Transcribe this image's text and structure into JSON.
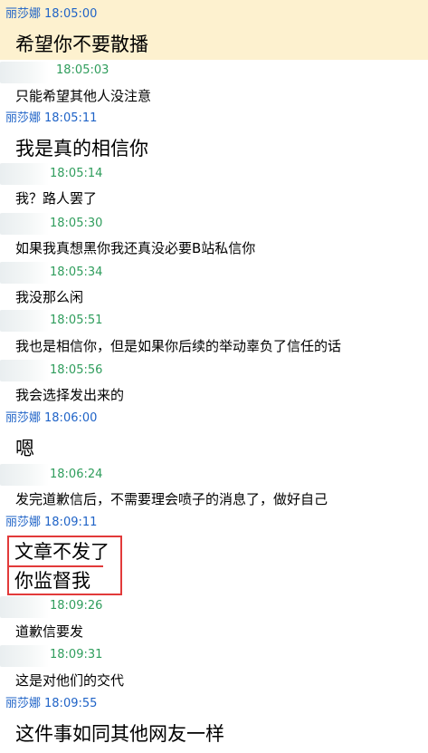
{
  "chat": {
    "highlight_color": "#fdf1cf",
    "accent_self": "#1f63c7",
    "accent_other": "#2f9d5c",
    "annotation_color": "#e23a3a",
    "messages": [
      {
        "sender": "丽莎娜",
        "time": "18:05:00",
        "text": "希望你不要散播"
      },
      {
        "sender": "",
        "time": "18:05:03",
        "text": "只能希望其他人没注意"
      },
      {
        "sender": "丽莎娜",
        "time": "18:05:11",
        "text": "我是真的相信你"
      },
      {
        "sender": "",
        "time": "18:05:14",
        "text": "我？路人罢了"
      },
      {
        "sender": "",
        "time": "18:05:30",
        "text": "如果我真想黑你我还真没必要B站私信你"
      },
      {
        "sender": "",
        "time": "18:05:34",
        "text": "我没那么闲"
      },
      {
        "sender": "",
        "time": "18:05:51",
        "text": "我也是相信你，但是如果你后续的举动辜负了信任的话"
      },
      {
        "sender": "",
        "time": "18:05:56",
        "text": "我会选择发出来的"
      },
      {
        "sender": "丽莎娜",
        "time": "18:06:00",
        "text": "嗯"
      },
      {
        "sender": "",
        "time": "18:06:24",
        "text": "发完道歉信后，不需要理会喷子的消息了，做好自己"
      },
      {
        "sender": "丽莎娜",
        "time": "18:09:11",
        "text": "文章不发了"
      },
      {
        "sender": "",
        "time": "",
        "text": "你监督我"
      },
      {
        "sender": "",
        "time": "18:09:26",
        "text": "道歉信要发"
      },
      {
        "sender": "",
        "time": "18:09:31",
        "text": "这是对他们的交代"
      },
      {
        "sender": "丽莎娜",
        "time": "18:09:55",
        "text": "这件事如同其他网友一样"
      }
    ]
  }
}
